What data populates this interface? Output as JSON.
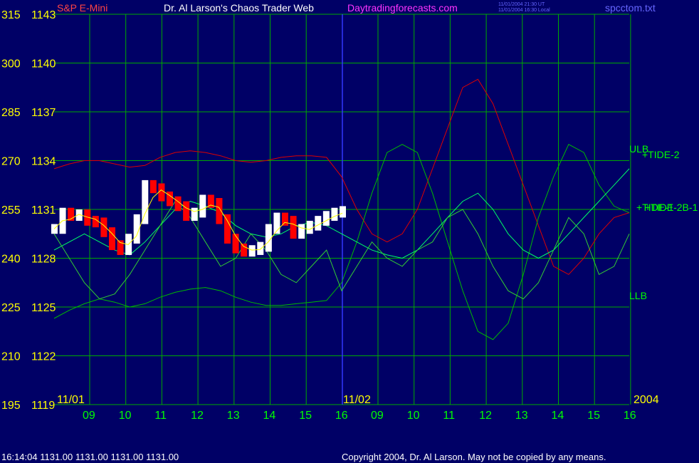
{
  "header": {
    "instrument": "S&P E-Mini",
    "title": "Dr. Al Larson's Chaos Trader Web",
    "site": "Daytradingforecasts.com",
    "time_ut": "11/01/2004 21:30 UT",
    "time_local": "11/01/2004 16:30 Local",
    "filename": "spcctom.txt"
  },
  "footer": {
    "quote": "16:14:04  1131.00 1131.00 1131.00 1131.00",
    "copyright": "Copyright 2004, Dr. Al Larson. May not be copied by any means."
  },
  "colors": {
    "background": "#000066",
    "grid": "#00aa00",
    "price_up": "#ffffff",
    "price_down": "#ff0000",
    "avg_line": "#ffff00",
    "band_red": "#dd0000",
    "band_green": "#00bb00",
    "divider": "#3333ff"
  },
  "chart_data": {
    "type": "line",
    "y_left_labels": [
      "315",
      "300",
      "285",
      "270",
      "255",
      "240",
      "225",
      "210",
      "195"
    ],
    "y_right_labels": [
      "1143",
      "1140",
      "1137",
      "1134",
      "1131",
      "1128",
      "1125",
      "1122",
      "1119"
    ],
    "ylim": [
      1119,
      1143
    ],
    "x_tick_labels": [
      "09",
      "10",
      "11",
      "12",
      "13",
      "14",
      "15",
      "16",
      "09",
      "10",
      "11",
      "12",
      "13",
      "14",
      "15",
      "16"
    ],
    "date_labels": [
      "11/01",
      "11/02",
      "2004"
    ],
    "series_labels": [
      "ULB",
      "+TIDE-2",
      "+TIDE-1",
      "+TIDE-2B-1",
      "LLB"
    ],
    "series": [
      {
        "name": "ULB",
        "color": "#dd0000",
        "y": [
          1133.5,
          1133.8,
          1134.0,
          1134.0,
          1133.8,
          1133.6,
          1133.7,
          1134.2,
          1134.5,
          1134.6,
          1134.5,
          1134.3,
          1134.0,
          1133.9,
          1134.0,
          1134.2,
          1134.3,
          1134.3,
          1134.2,
          1133.0,
          1131.0,
          1129.5,
          1129.0,
          1129.5,
          1131.0,
          1133.5,
          1136.0,
          1138.5,
          1139.0,
          1137.5,
          1135.0,
          1132.5,
          1130.0,
          1127.5,
          1127.0,
          1128.0,
          1129.5,
          1130.5,
          1130.8
        ]
      },
      {
        "name": "LLB",
        "color": "#00bb00",
        "y": [
          1124.3,
          1124.8,
          1125.2,
          1125.5,
          1125.3,
          1125.0,
          1125.2,
          1125.6,
          1125.9,
          1126.1,
          1126.2,
          1126.0,
          1125.6,
          1125.3,
          1125.1,
          1125.1,
          1125.2,
          1125.3,
          1125.4,
          1126.5,
          1129.0,
          1132.0,
          1134.5,
          1135.0,
          1134.5,
          1132.0,
          1129.0,
          1126.0,
          1123.5,
          1123.0,
          1124.0,
          1127.0,
          1130.5,
          1133.0,
          1135.0,
          1134.5,
          1132.5,
          1131.2,
          1130.8
        ]
      },
      {
        "name": "+TIDE-2",
        "color": "#00ff66",
        "y": [
          1128.5,
          1129.0,
          1129.5,
          1129.0,
          1128.5,
          1128.2,
          1129.0,
          1130.0,
          1131.0,
          1131.5,
          1131.2,
          1130.8,
          1130.0,
          1129.5,
          1129.3,
          1129.5,
          1130.0,
          1130.2,
          1130.0,
          1129.5,
          1129.0,
          1128.5,
          1128.2,
          1128.0,
          1128.5,
          1129.5,
          1130.5,
          1131.5,
          1132.0,
          1131.0,
          1129.5,
          1128.5,
          1128.0,
          1128.5,
          1129.5,
          1130.5,
          1131.5,
          1132.5,
          1133.5
        ]
      },
      {
        "name": "+TIDE-1",
        "color": "#33cc33",
        "y": [
          1129.5,
          1128.0,
          1126.5,
          1125.5,
          1125.8,
          1127.0,
          1128.5,
          1130.0,
          1131.5,
          1130.5,
          1129.0,
          1127.5,
          1128.0,
          1129.5,
          1128.5,
          1127.0,
          1126.5,
          1127.5,
          1128.5,
          1126.0,
          1127.5,
          1129.0,
          1128.0,
          1127.5,
          1128.5,
          1129.0,
          1130.5,
          1131.0,
          1129.5,
          1127.5,
          1126.0,
          1125.5,
          1126.5,
          1128.5,
          1130.5,
          1129.5,
          1127.0,
          1127.5,
          1129.5
        ]
      },
      {
        "name": "price",
        "color": "#ffffff",
        "y": [
          1129.8,
          1130.8,
          1130.6,
          1130.7,
          1130.3,
          1130.2,
          1129.6,
          1128.8,
          1128.5,
          1129.2,
          1130.4,
          1132.5,
          1132.3,
          1131.8,
          1131.5,
          1131.2,
          1130.6,
          1130.8,
          1131.6,
          1131.4,
          1130.4,
          1129.2,
          1128.6,
          1128.4,
          1128.5,
          1128.7,
          1129.8,
          1130.5,
          1130.3,
          1129.5,
          1129.8,
          1130.0,
          1130.3,
          1130.6,
          1130.8,
          1130.9
        ]
      }
    ]
  }
}
